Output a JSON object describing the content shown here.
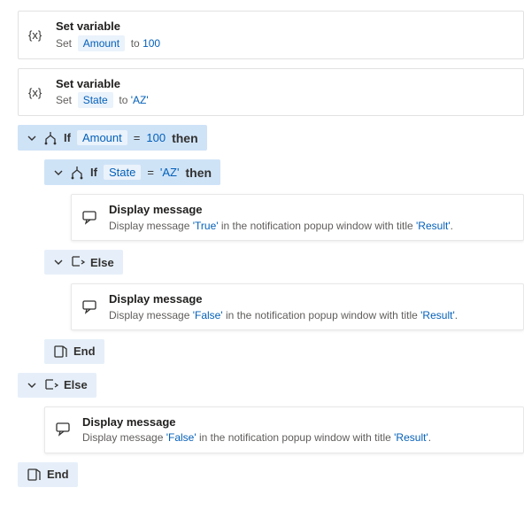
{
  "setVar": {
    "title": "Set variable",
    "setWord": "Set",
    "toWord": "to",
    "amountVar": "Amount",
    "amountVal": "100",
    "stateVar": "State",
    "stateVal": "'AZ'"
  },
  "ifWord": "If",
  "elseWord": "Else",
  "endWord": "End",
  "thenWord": "then",
  "eqOp": "=",
  "outerIf": {
    "var": "Amount",
    "val": "100"
  },
  "innerIf": {
    "var": "State",
    "val": "'AZ'"
  },
  "msg": {
    "title": "Display message",
    "pre": "Display message",
    "mid": "in the notification popup window with title",
    "valTrue": "'True'",
    "valFalse": "'False'",
    "resultTitle": "'Result'",
    "dot": "."
  }
}
